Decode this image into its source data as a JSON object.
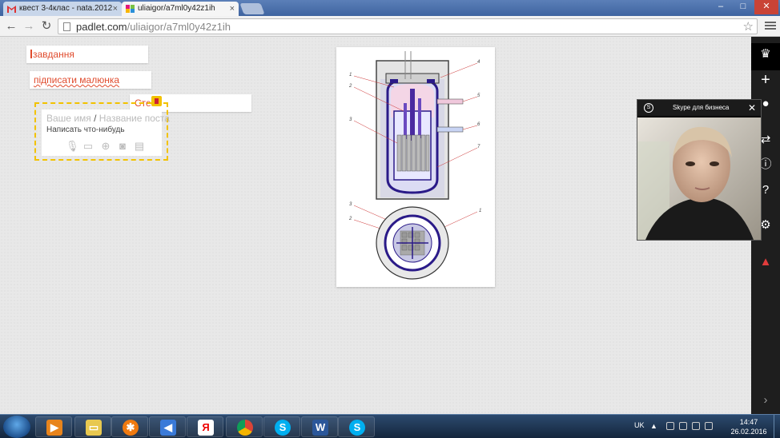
{
  "browser": {
    "tabs": [
      {
        "title": "квест 3-4клас - nata.2012",
        "active": false
      },
      {
        "title": "uliaigor/a7ml0y42z1ih",
        "active": true
      },
      {
        "title": "",
        "active": false
      }
    ],
    "url_host": "padlet.com",
    "url_path": "/uliaigor/a7ml0y42z1ih",
    "window_controls": [
      "–",
      "□",
      "✕"
    ]
  },
  "padlet": {
    "posts": [
      {
        "title": "завдання"
      },
      {
        "title": "підписати малюнка"
      },
      {
        "title": "Сте"
      }
    ],
    "composer": {
      "name_placeholder": "Ваше имя",
      "separator": "/",
      "title_placeholder": "Название поста",
      "body_placeholder": "Написать что-нибудь"
    },
    "diagram_labels": [
      "1",
      "2",
      "3",
      "4",
      "5",
      "6",
      "7",
      "3",
      "2",
      "1"
    ]
  },
  "sidebar": {
    "icons": [
      "crown-icon",
      "plus-icon",
      "user-icon",
      "share-icon",
      "info-icon",
      "help-icon",
      "gear-icon",
      "warning-icon",
      "chevron-right-icon"
    ]
  },
  "skype": {
    "title": "Skype для бизнеса",
    "close": "✕"
  },
  "taskbar": {
    "language": "UK",
    "time": "14:47",
    "date": "26.02.2016"
  },
  "colors": {
    "accent_red": "#e04b2d",
    "composer_dash": "#f2c200",
    "sidebar_bg": "#1e1e1e"
  }
}
